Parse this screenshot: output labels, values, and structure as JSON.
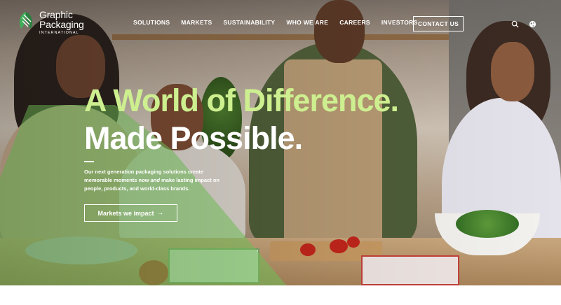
{
  "brand": {
    "name_line1": "Graphic",
    "name_line2": "Packaging",
    "name_sub": "INTERNATIONAL",
    "accent_color": "#2e8b57"
  },
  "nav": {
    "items": [
      "SOLUTIONS",
      "MARKETS",
      "SUSTAINABILITY",
      "WHO WE ARE",
      "CAREERS",
      "INVESTORS"
    ],
    "contact_label": "CONTACT US",
    "icons": [
      "search-icon",
      "globe-icon"
    ]
  },
  "hero": {
    "headline_line1": "A World of Difference.",
    "headline_line2": "Made Possible.",
    "headline_line1_color": "#cdef8f",
    "desc_part1": "Our next generation packaging solutions create memorable moments now ",
    "desc_emph": "and",
    "desc_part2": " make lasting impact on people, products, and world-class brands.",
    "cta_label": "Markets we impact",
    "cta_icon": "arrow-right-icon"
  }
}
